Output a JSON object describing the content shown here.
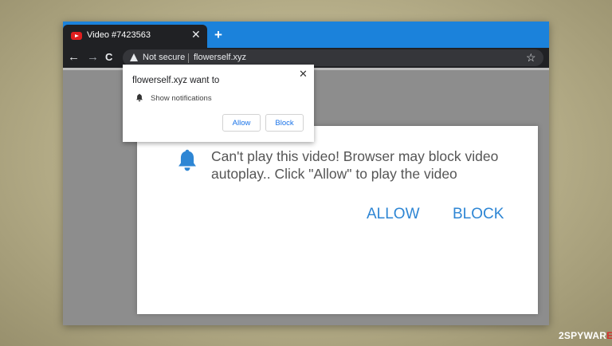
{
  "tab": {
    "title": "Video #7423563",
    "icon": "youtube-icon",
    "close": "✕"
  },
  "newtab": {
    "label": "+"
  },
  "toolbar": {
    "back": "←",
    "forward": "→",
    "reload": "C",
    "security_label": "Not secure",
    "url": "flowerself.xyz",
    "bookmark": "☆"
  },
  "popup": {
    "title": "flowerself.xyz want to",
    "close": "✕",
    "permission": "Show notifications",
    "allow": "Allow",
    "block": "Block"
  },
  "modal": {
    "message": "Can't play this video! Browser may block video autoplay.. Click \"Allow\" to play the video",
    "allow": "ALLOW",
    "block": "BLOCK"
  },
  "watermark": {
    "prefix": "2",
    "middle": "SPYWAR",
    "suffix": "E"
  },
  "colors": {
    "tabstrip": "#1b82db",
    "toolbar": "#202124",
    "link_blue": "#2e86d4",
    "bell_blue": "#2e86d4"
  }
}
